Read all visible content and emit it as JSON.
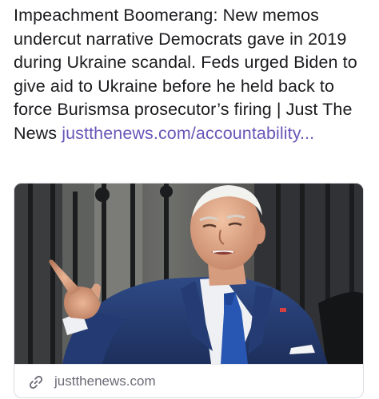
{
  "post": {
    "text": "Impeachment Boomerang: New memos undercut narrative Democrats gave in 2019 during Ukraine scandal. Feds urged Biden to give aid to Ukraine before he held back to force Burismsa prosecutor’s firing | Just The News ",
    "link_text": "justthenews.com/​accountability..."
  },
  "link_card": {
    "domain": "justthenews.com",
    "link_icon": "link-chain-icon",
    "image": "photo-man-in-navy-suit-pointing"
  },
  "colors": {
    "text": "#1b1b1f",
    "link": "#6a56b8",
    "domain": "#6b6b76",
    "card_border": "#dcdbe3"
  }
}
